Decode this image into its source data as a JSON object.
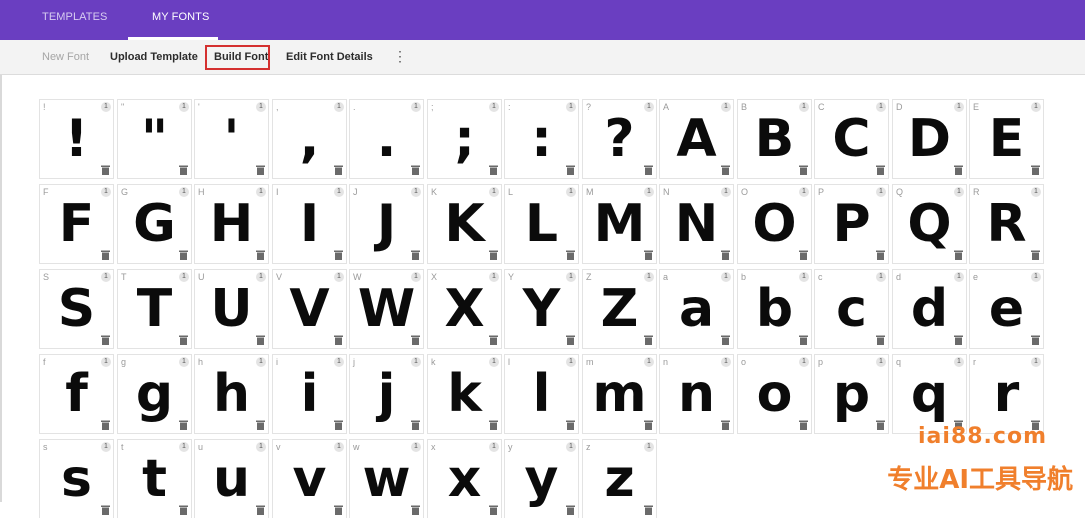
{
  "tabs": [
    {
      "label": "TEMPLATES",
      "active": false
    },
    {
      "label": "MY FONTS",
      "active": true
    }
  ],
  "toolbar": {
    "new_font": "New Font",
    "upload_template": "Upload Template",
    "build_font": "Build Font",
    "edit_details": "Edit Font Details",
    "more": "⋮"
  },
  "glyph_rows": [
    [
      {
        "label": "!",
        "char": "!"
      },
      {
        "label": "\"",
        "char": "\""
      },
      {
        "label": "'",
        "char": "'"
      },
      {
        "label": ",",
        "char": ","
      },
      {
        "label": ".",
        "char": "."
      },
      {
        "label": ";",
        "char": ";"
      },
      {
        "label": ":",
        "char": ":"
      },
      {
        "label": "?",
        "char": "?"
      },
      {
        "label": "A",
        "char": "A"
      },
      {
        "label": "B",
        "char": "B"
      },
      {
        "label": "C",
        "char": "C"
      },
      {
        "label": "D",
        "char": "D"
      },
      {
        "label": "E",
        "char": "E"
      }
    ],
    [
      {
        "label": "F",
        "char": "F"
      },
      {
        "label": "G",
        "char": "G"
      },
      {
        "label": "H",
        "char": "H"
      },
      {
        "label": "I",
        "char": "I"
      },
      {
        "label": "J",
        "char": "J"
      },
      {
        "label": "K",
        "char": "K"
      },
      {
        "label": "L",
        "char": "L"
      },
      {
        "label": "M",
        "char": "M"
      },
      {
        "label": "N",
        "char": "N"
      },
      {
        "label": "O",
        "char": "O"
      },
      {
        "label": "P",
        "char": "P"
      },
      {
        "label": "Q",
        "char": "Q"
      },
      {
        "label": "R",
        "char": "R"
      }
    ],
    [
      {
        "label": "S",
        "char": "S"
      },
      {
        "label": "T",
        "char": "T"
      },
      {
        "label": "U",
        "char": "U"
      },
      {
        "label": "V",
        "char": "V"
      },
      {
        "label": "W",
        "char": "W"
      },
      {
        "label": "X",
        "char": "X"
      },
      {
        "label": "Y",
        "char": "Y"
      },
      {
        "label": "Z",
        "char": "Z"
      },
      {
        "label": "a",
        "char": "a"
      },
      {
        "label": "b",
        "char": "b"
      },
      {
        "label": "c",
        "char": "c"
      },
      {
        "label": "d",
        "char": "d"
      },
      {
        "label": "e",
        "char": "e"
      }
    ],
    [
      {
        "label": "f",
        "char": "f"
      },
      {
        "label": "g",
        "char": "g"
      },
      {
        "label": "h",
        "char": "h"
      },
      {
        "label": "i",
        "char": "i"
      },
      {
        "label": "j",
        "char": "j"
      },
      {
        "label": "k",
        "char": "k"
      },
      {
        "label": "l",
        "char": "l"
      },
      {
        "label": "m",
        "char": "m"
      },
      {
        "label": "n",
        "char": "n"
      },
      {
        "label": "o",
        "char": "o"
      },
      {
        "label": "p",
        "char": "p"
      },
      {
        "label": "q",
        "char": "q"
      },
      {
        "label": "r",
        "char": "r"
      }
    ],
    [
      {
        "label": "s",
        "char": "s"
      },
      {
        "label": "t",
        "char": "t"
      },
      {
        "label": "u",
        "char": "u"
      },
      {
        "label": "v",
        "char": "v"
      },
      {
        "label": "w",
        "char": "w"
      },
      {
        "label": "x",
        "char": "x"
      },
      {
        "label": "y",
        "char": "y"
      },
      {
        "label": "z",
        "char": "z"
      }
    ]
  ],
  "info_badge": "1",
  "watermark": {
    "line1": "iai88.com",
    "line2": "专业AI工具导航"
  },
  "colors": {
    "header": "#6a3ec1",
    "highlight_border": "#d4302f",
    "watermark": "#f07f2c"
  }
}
